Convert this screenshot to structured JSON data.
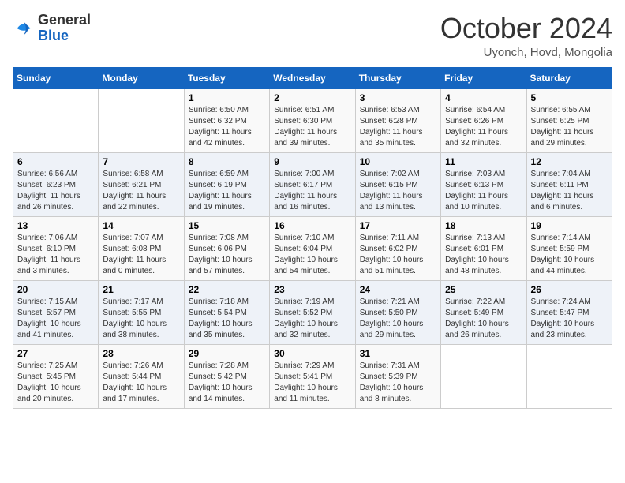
{
  "header": {
    "logo": {
      "general": "General",
      "blue": "Blue"
    },
    "month": "October 2024",
    "location": "Uyonch, Hovd, Mongolia"
  },
  "days_of_week": [
    "Sunday",
    "Monday",
    "Tuesday",
    "Wednesday",
    "Thursday",
    "Friday",
    "Saturday"
  ],
  "weeks": [
    [
      {
        "day": "",
        "info": ""
      },
      {
        "day": "",
        "info": ""
      },
      {
        "day": "1",
        "info": "Sunrise: 6:50 AM\nSunset: 6:32 PM\nDaylight: 11 hours and 42 minutes."
      },
      {
        "day": "2",
        "info": "Sunrise: 6:51 AM\nSunset: 6:30 PM\nDaylight: 11 hours and 39 minutes."
      },
      {
        "day": "3",
        "info": "Sunrise: 6:53 AM\nSunset: 6:28 PM\nDaylight: 11 hours and 35 minutes."
      },
      {
        "day": "4",
        "info": "Sunrise: 6:54 AM\nSunset: 6:26 PM\nDaylight: 11 hours and 32 minutes."
      },
      {
        "day": "5",
        "info": "Sunrise: 6:55 AM\nSunset: 6:25 PM\nDaylight: 11 hours and 29 minutes."
      }
    ],
    [
      {
        "day": "6",
        "info": "Sunrise: 6:56 AM\nSunset: 6:23 PM\nDaylight: 11 hours and 26 minutes."
      },
      {
        "day": "7",
        "info": "Sunrise: 6:58 AM\nSunset: 6:21 PM\nDaylight: 11 hours and 22 minutes."
      },
      {
        "day": "8",
        "info": "Sunrise: 6:59 AM\nSunset: 6:19 PM\nDaylight: 11 hours and 19 minutes."
      },
      {
        "day": "9",
        "info": "Sunrise: 7:00 AM\nSunset: 6:17 PM\nDaylight: 11 hours and 16 minutes."
      },
      {
        "day": "10",
        "info": "Sunrise: 7:02 AM\nSunset: 6:15 PM\nDaylight: 11 hours and 13 minutes."
      },
      {
        "day": "11",
        "info": "Sunrise: 7:03 AM\nSunset: 6:13 PM\nDaylight: 11 hours and 10 minutes."
      },
      {
        "day": "12",
        "info": "Sunrise: 7:04 AM\nSunset: 6:11 PM\nDaylight: 11 hours and 6 minutes."
      }
    ],
    [
      {
        "day": "13",
        "info": "Sunrise: 7:06 AM\nSunset: 6:10 PM\nDaylight: 11 hours and 3 minutes."
      },
      {
        "day": "14",
        "info": "Sunrise: 7:07 AM\nSunset: 6:08 PM\nDaylight: 11 hours and 0 minutes."
      },
      {
        "day": "15",
        "info": "Sunrise: 7:08 AM\nSunset: 6:06 PM\nDaylight: 10 hours and 57 minutes."
      },
      {
        "day": "16",
        "info": "Sunrise: 7:10 AM\nSunset: 6:04 PM\nDaylight: 10 hours and 54 minutes."
      },
      {
        "day": "17",
        "info": "Sunrise: 7:11 AM\nSunset: 6:02 PM\nDaylight: 10 hours and 51 minutes."
      },
      {
        "day": "18",
        "info": "Sunrise: 7:13 AM\nSunset: 6:01 PM\nDaylight: 10 hours and 48 minutes."
      },
      {
        "day": "19",
        "info": "Sunrise: 7:14 AM\nSunset: 5:59 PM\nDaylight: 10 hours and 44 minutes."
      }
    ],
    [
      {
        "day": "20",
        "info": "Sunrise: 7:15 AM\nSunset: 5:57 PM\nDaylight: 10 hours and 41 minutes."
      },
      {
        "day": "21",
        "info": "Sunrise: 7:17 AM\nSunset: 5:55 PM\nDaylight: 10 hours and 38 minutes."
      },
      {
        "day": "22",
        "info": "Sunrise: 7:18 AM\nSunset: 5:54 PM\nDaylight: 10 hours and 35 minutes."
      },
      {
        "day": "23",
        "info": "Sunrise: 7:19 AM\nSunset: 5:52 PM\nDaylight: 10 hours and 32 minutes."
      },
      {
        "day": "24",
        "info": "Sunrise: 7:21 AM\nSunset: 5:50 PM\nDaylight: 10 hours and 29 minutes."
      },
      {
        "day": "25",
        "info": "Sunrise: 7:22 AM\nSunset: 5:49 PM\nDaylight: 10 hours and 26 minutes."
      },
      {
        "day": "26",
        "info": "Sunrise: 7:24 AM\nSunset: 5:47 PM\nDaylight: 10 hours and 23 minutes."
      }
    ],
    [
      {
        "day": "27",
        "info": "Sunrise: 7:25 AM\nSunset: 5:45 PM\nDaylight: 10 hours and 20 minutes."
      },
      {
        "day": "28",
        "info": "Sunrise: 7:26 AM\nSunset: 5:44 PM\nDaylight: 10 hours and 17 minutes."
      },
      {
        "day": "29",
        "info": "Sunrise: 7:28 AM\nSunset: 5:42 PM\nDaylight: 10 hours and 14 minutes."
      },
      {
        "day": "30",
        "info": "Sunrise: 7:29 AM\nSunset: 5:41 PM\nDaylight: 10 hours and 11 minutes."
      },
      {
        "day": "31",
        "info": "Sunrise: 7:31 AM\nSunset: 5:39 PM\nDaylight: 10 hours and 8 minutes."
      },
      {
        "day": "",
        "info": ""
      },
      {
        "day": "",
        "info": ""
      }
    ]
  ]
}
